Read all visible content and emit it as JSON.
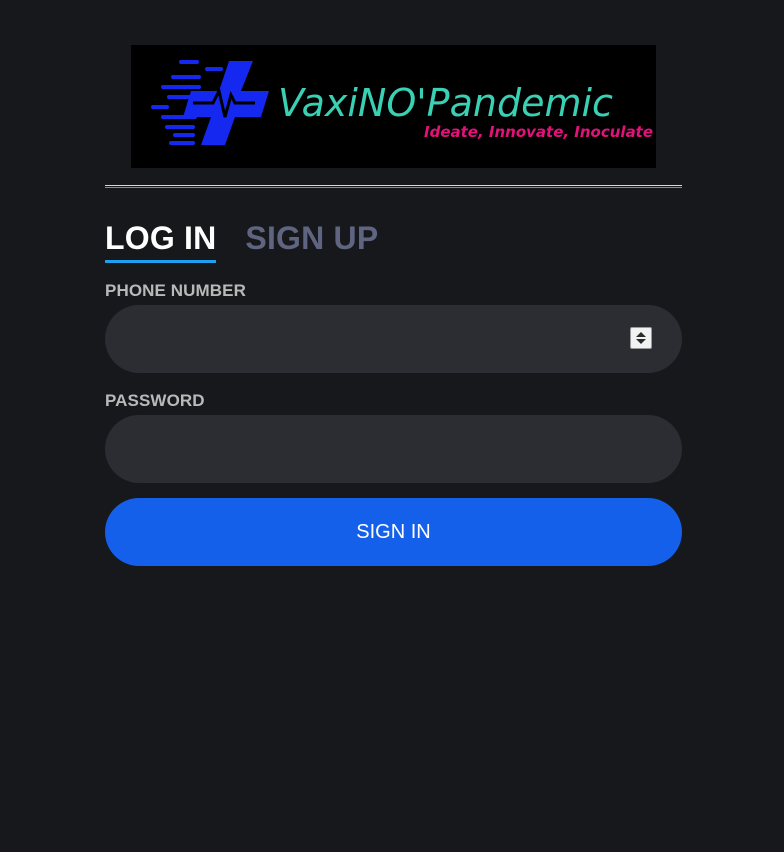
{
  "logo": {
    "brand": "VaxiNO'Pandemic",
    "tagline": "Ideate, Innovate, Inoculate",
    "icon": "medical-cross-pulse-icon",
    "colors": {
      "background": "#000000",
      "brand_text": "#3ad0b4",
      "tagline_text": "#e2127a",
      "mark": "#1428f0"
    }
  },
  "tabs": [
    {
      "label": "LOG IN",
      "active": true
    },
    {
      "label": "SIGN UP",
      "active": false
    }
  ],
  "form": {
    "phone_label": "PHONE NUMBER",
    "phone_value": "",
    "password_label": "PASSWORD",
    "password_value": "",
    "submit_label": "SIGN IN"
  },
  "colors": {
    "page_background": "#17181c",
    "field_background": "#2c2d32",
    "primary_button": "#1460ea",
    "tab_underline": "#1f9ff0",
    "inactive_tab": "#5f6480"
  }
}
